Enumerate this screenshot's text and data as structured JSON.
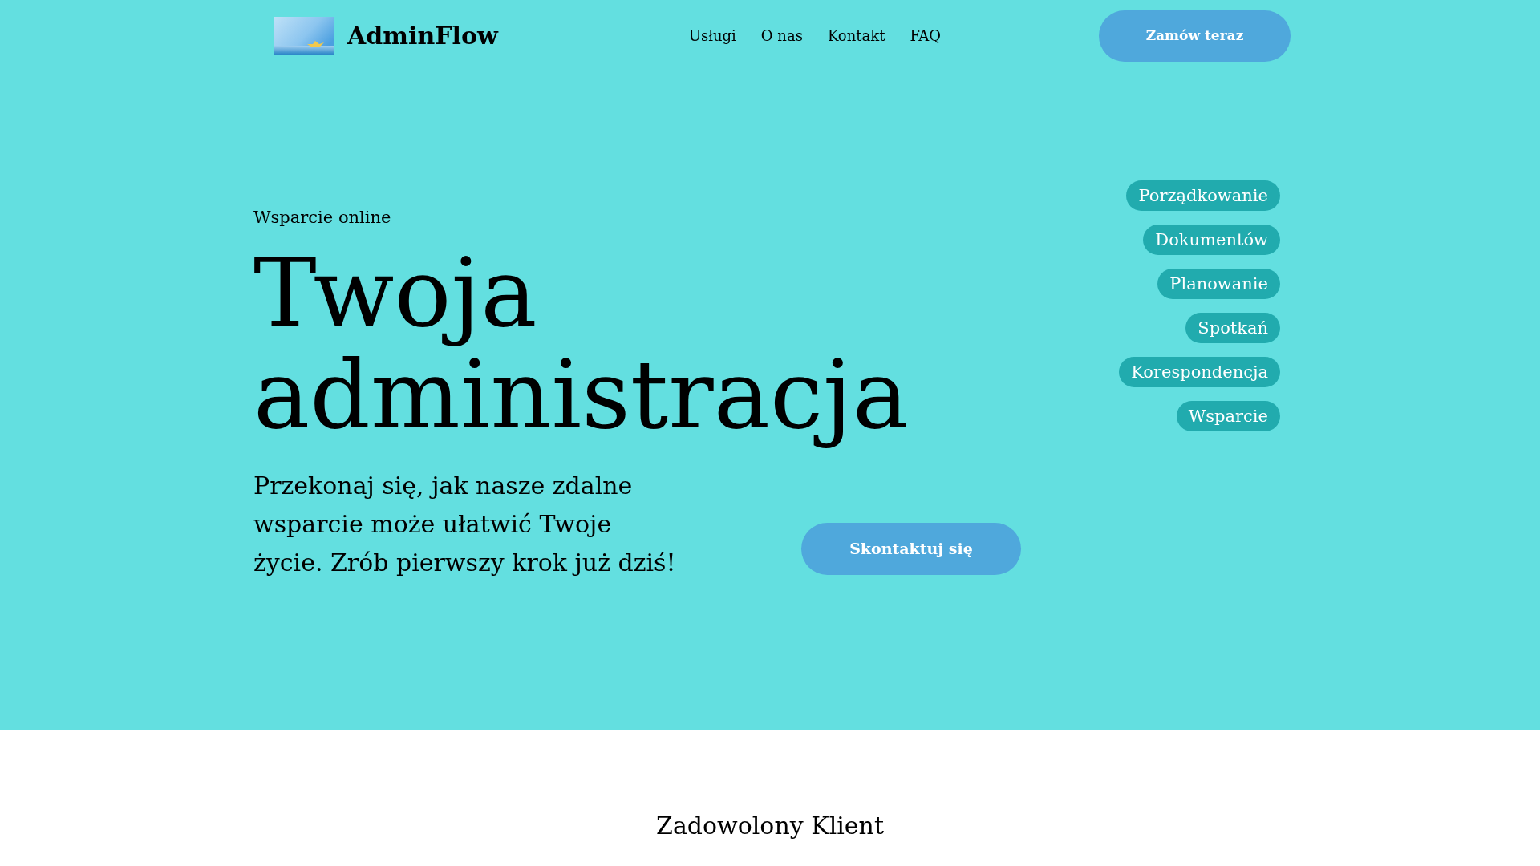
{
  "header": {
    "brand": "AdminFlow",
    "nav": [
      {
        "label": "Usługi"
      },
      {
        "label": "O nas"
      },
      {
        "label": "Kontakt"
      },
      {
        "label": "FAQ"
      }
    ],
    "cta": "Zamów teraz"
  },
  "hero": {
    "eyebrow": "Wsparcie online",
    "title": "Twoja administracja",
    "description": "Przekonaj się, jak nasze zdalne wsparcie może ułatwić Twoje życie. Zrób pierwszy krok już dziś!",
    "button": "Skontaktuj się",
    "tags": [
      "Porządkowanie",
      "Dokumentów",
      "Planowanie",
      "Spotkań",
      "Korespondencja",
      "Wsparcie"
    ]
  },
  "testimonial": {
    "label": "Zadowolony Klient"
  }
}
